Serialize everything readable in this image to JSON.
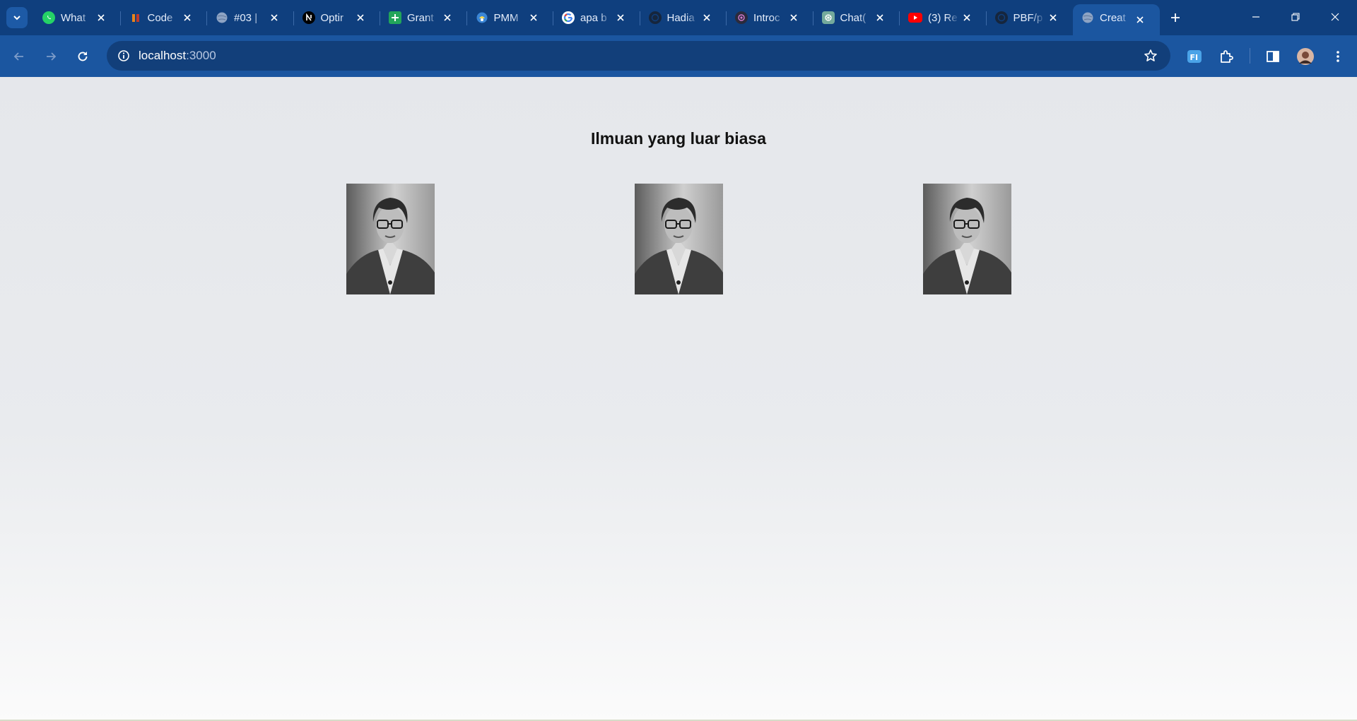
{
  "browser": {
    "tabs": [
      {
        "title": "What",
        "icon": "whatsapp-icon",
        "color": "#25d366"
      },
      {
        "title": "Code",
        "icon": "codepolitan-icon",
        "color": "#e8841b"
      },
      {
        "title": "#03 |",
        "icon": "globe-icon",
        "color": "#8ea4c4"
      },
      {
        "title": "Optir",
        "icon": "nextjs-icon",
        "color": "#000000"
      },
      {
        "title": "Grant",
        "icon": "sheets-icon",
        "color": "#22a55a"
      },
      {
        "title": "PMM",
        "icon": "kemdikbud-icon",
        "color": "#3b86d6"
      },
      {
        "title": "apa b",
        "icon": "google-icon",
        "color": "#ffffff"
      },
      {
        "title": "Hadia",
        "icon": "github-icon",
        "color": "#16263d"
      },
      {
        "title": "Introc",
        "icon": "tailwind-icon",
        "color": "#2b2b3c"
      },
      {
        "title": "Chat(",
        "icon": "chatgpt-icon",
        "color": "#74aa9c"
      },
      {
        "title": "(3) Re",
        "icon": "youtube-icon",
        "color": "#ff0000"
      },
      {
        "title": "PBF/p",
        "icon": "github-icon",
        "color": "#16263d"
      },
      {
        "title": "Creat",
        "icon": "globe-icon",
        "color": "#8ea4c4",
        "active": true
      }
    ],
    "address_host": "localhost",
    "address_port": ":3000"
  },
  "page": {
    "title": "Ilmuan yang luar biasa",
    "images": [
      {
        "alt": "scientist-photo"
      },
      {
        "alt": "scientist-photo"
      },
      {
        "alt": "scientist-photo"
      }
    ]
  }
}
